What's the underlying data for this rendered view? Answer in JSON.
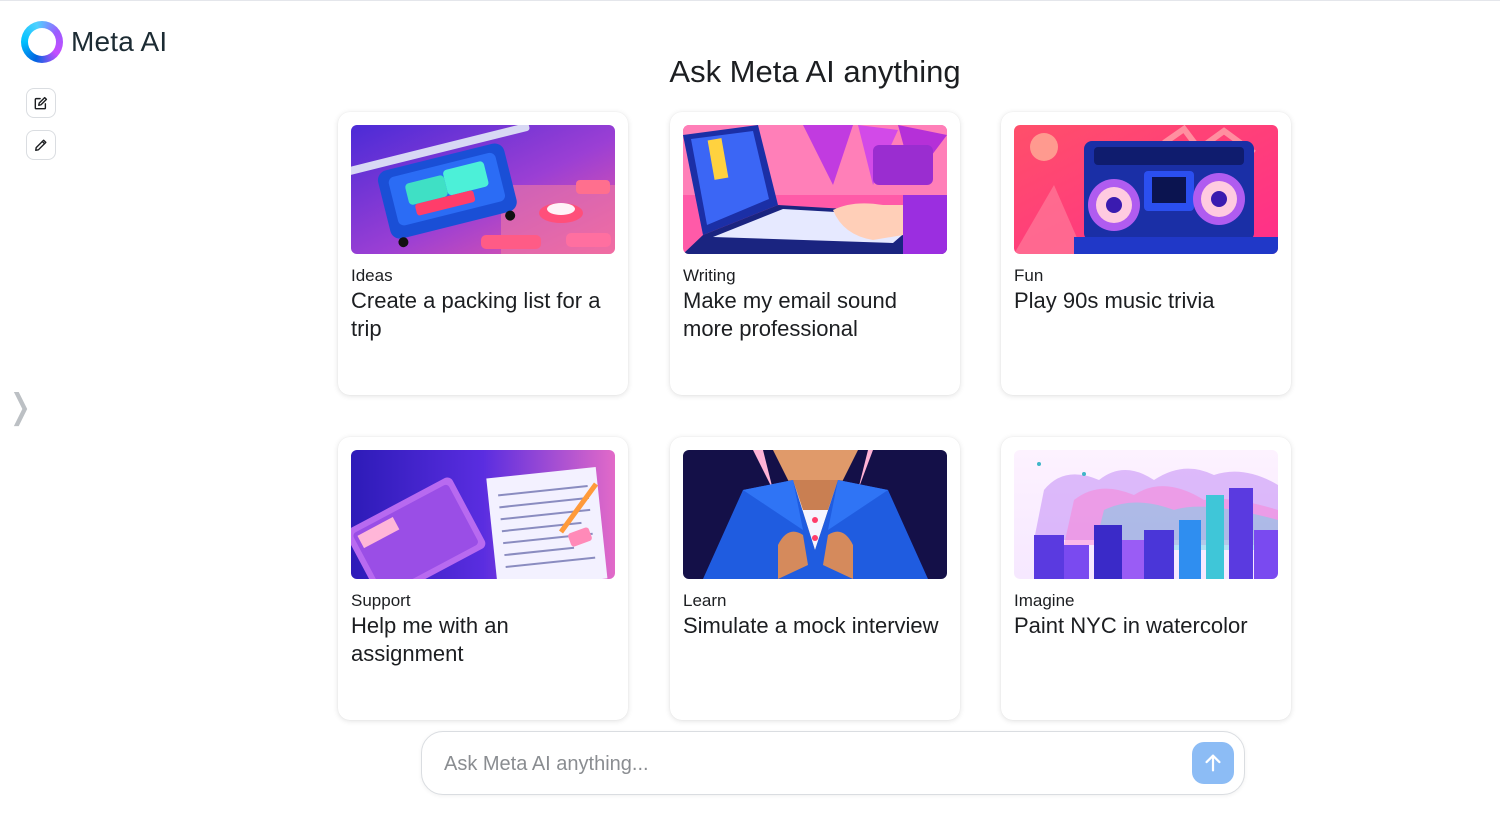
{
  "app": {
    "name": "Meta AI"
  },
  "sidebar": {
    "new_chat_icon": "new-chat-icon",
    "edit_icon": "pencil-icon",
    "expand_icon": "chevron-right-icon"
  },
  "main": {
    "heading": "Ask Meta AI anything",
    "cards": [
      {
        "category": "Ideas",
        "title": "Create a packing list for a trip",
        "image": "suitcase-illustration"
      },
      {
        "category": "Writing",
        "title": "Make my email sound more professional",
        "image": "laptop-typing-illustration"
      },
      {
        "category": "Fun",
        "title": "Play 90s music trivia",
        "image": "boombox-illustration"
      },
      {
        "category": "Support",
        "title": "Help me with an assignment",
        "image": "book-and-paper-illustration"
      },
      {
        "category": "Learn",
        "title": "Simulate a mock interview",
        "image": "person-in-suit-illustration"
      },
      {
        "category": "Imagine",
        "title": "Paint NYC in watercolor",
        "image": "watercolor-skyline-illustration"
      }
    ]
  },
  "composer": {
    "placeholder": "Ask Meta AI anything...",
    "send_icon": "arrow-up-icon"
  },
  "colors": {
    "accent": "#0064e0",
    "send_button": "#8cbcf5",
    "text": "#1c1e21",
    "placeholder": "#8a8d91"
  }
}
